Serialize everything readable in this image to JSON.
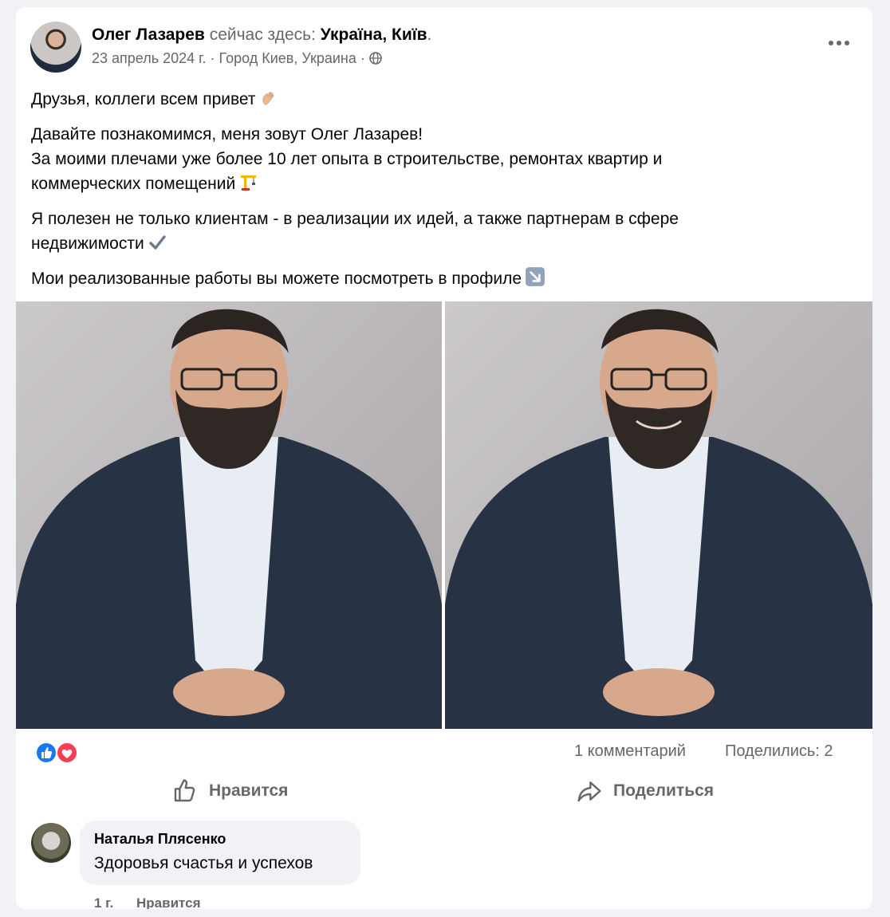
{
  "post": {
    "author": "Олег Лазарев",
    "checkin_prefix": "сейчас здесь:",
    "place": "Україна, Київ",
    "place_suffix": ".",
    "date": "23 апрель 2024 г.",
    "separator": "·",
    "location": "Город Киев, Украина",
    "paragraphs": [
      {
        "text": "Друзья, коллеги всем привет",
        "emoji": "waving-hand"
      },
      {
        "line1": "Давайте познакомимся, меня зовут Олег Лазарев!",
        "line2": "За моими плечами уже более 10 лет опыта в строительстве, ремонтах квартир и",
        "line3": "коммерческих помещений",
        "emoji": "construction-crane"
      },
      {
        "line1": "Я полезен не только клиентам - в реализации их идей, а также партнерам в сфере",
        "line2": "недвижимости",
        "emoji": "check-mark"
      },
      {
        "text": "Мои реализованные работы вы можете посмотреть в профиле",
        "emoji": "arrow-down-right"
      }
    ],
    "photos": [
      "photo-portrait-neutral",
      "photo-portrait-smiling"
    ]
  },
  "stats": {
    "reactions": [
      "like",
      "love"
    ],
    "comments": "1 комментарий",
    "shares": "Поделились: 2"
  },
  "actions": {
    "like": "Нравится",
    "share": "Поделиться"
  },
  "comment": {
    "author": "Наталья Плясенко",
    "text": "Здоровья счастья и успехов",
    "age": "1 г.",
    "like": "Нравится"
  },
  "colors": {
    "like_blue": "#1877f2",
    "love_red": "#f33e58",
    "muted_text": "#65676b"
  }
}
